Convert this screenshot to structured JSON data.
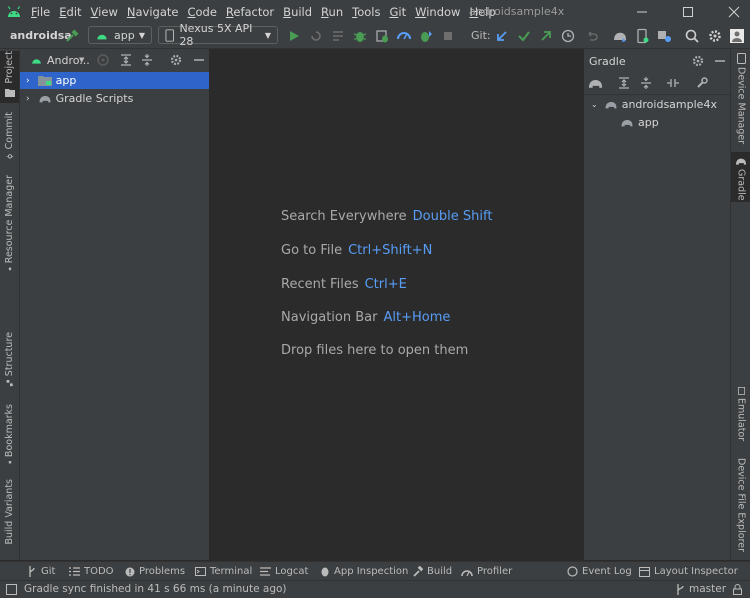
{
  "menu": [
    "File",
    "Edit",
    "View",
    "Navigate",
    "Code",
    "Refactor",
    "Build",
    "Run",
    "Tools",
    "Git",
    "Window",
    "Help"
  ],
  "window_title": "androidsample4x",
  "toolbar": {
    "project_short": "androidsa",
    "run_config": "app",
    "device": "Nexus 5X API 28",
    "git_label": "Git:"
  },
  "left_tabs": [
    "Project",
    "Commit",
    "Resource Manager",
    "Structure",
    "Bookmarks",
    "Build Variants"
  ],
  "project_panel": {
    "view_label": "Andro...",
    "tree": [
      {
        "label": "app",
        "selected": true
      },
      {
        "label": "Gradle Scripts",
        "selected": false
      }
    ]
  },
  "editor": {
    "hints": [
      {
        "text": "Search Everywhere",
        "key": "Double Shift"
      },
      {
        "text": "Go to File",
        "key": "Ctrl+Shift+N"
      },
      {
        "text": "Recent Files",
        "key": "Ctrl+E"
      },
      {
        "text": "Navigation Bar",
        "key": "Alt+Home"
      },
      {
        "text": "Drop files here to open them",
        "key": ""
      }
    ]
  },
  "gradle_panel": {
    "title": "Gradle",
    "tree": [
      {
        "label": "androidsample4x"
      },
      {
        "label": "app"
      }
    ]
  },
  "right_tabs": [
    "Device Manager",
    "Gradle",
    "Emulator",
    "Device File Explorer"
  ],
  "bottom_tabs": [
    "Git",
    "TODO",
    "Problems",
    "Terminal",
    "Logcat",
    "App Inspection",
    "Build",
    "Profiler",
    "Event Log",
    "Layout Inspector"
  ],
  "status": {
    "message": "Gradle sync finished in 41 s 66 ms (a minute ago)",
    "branch": "master"
  },
  "colors": {
    "accent": "#589df6",
    "selection": "#2f65ca",
    "android_green": "#3ddc84",
    "run_green": "#499c54"
  }
}
